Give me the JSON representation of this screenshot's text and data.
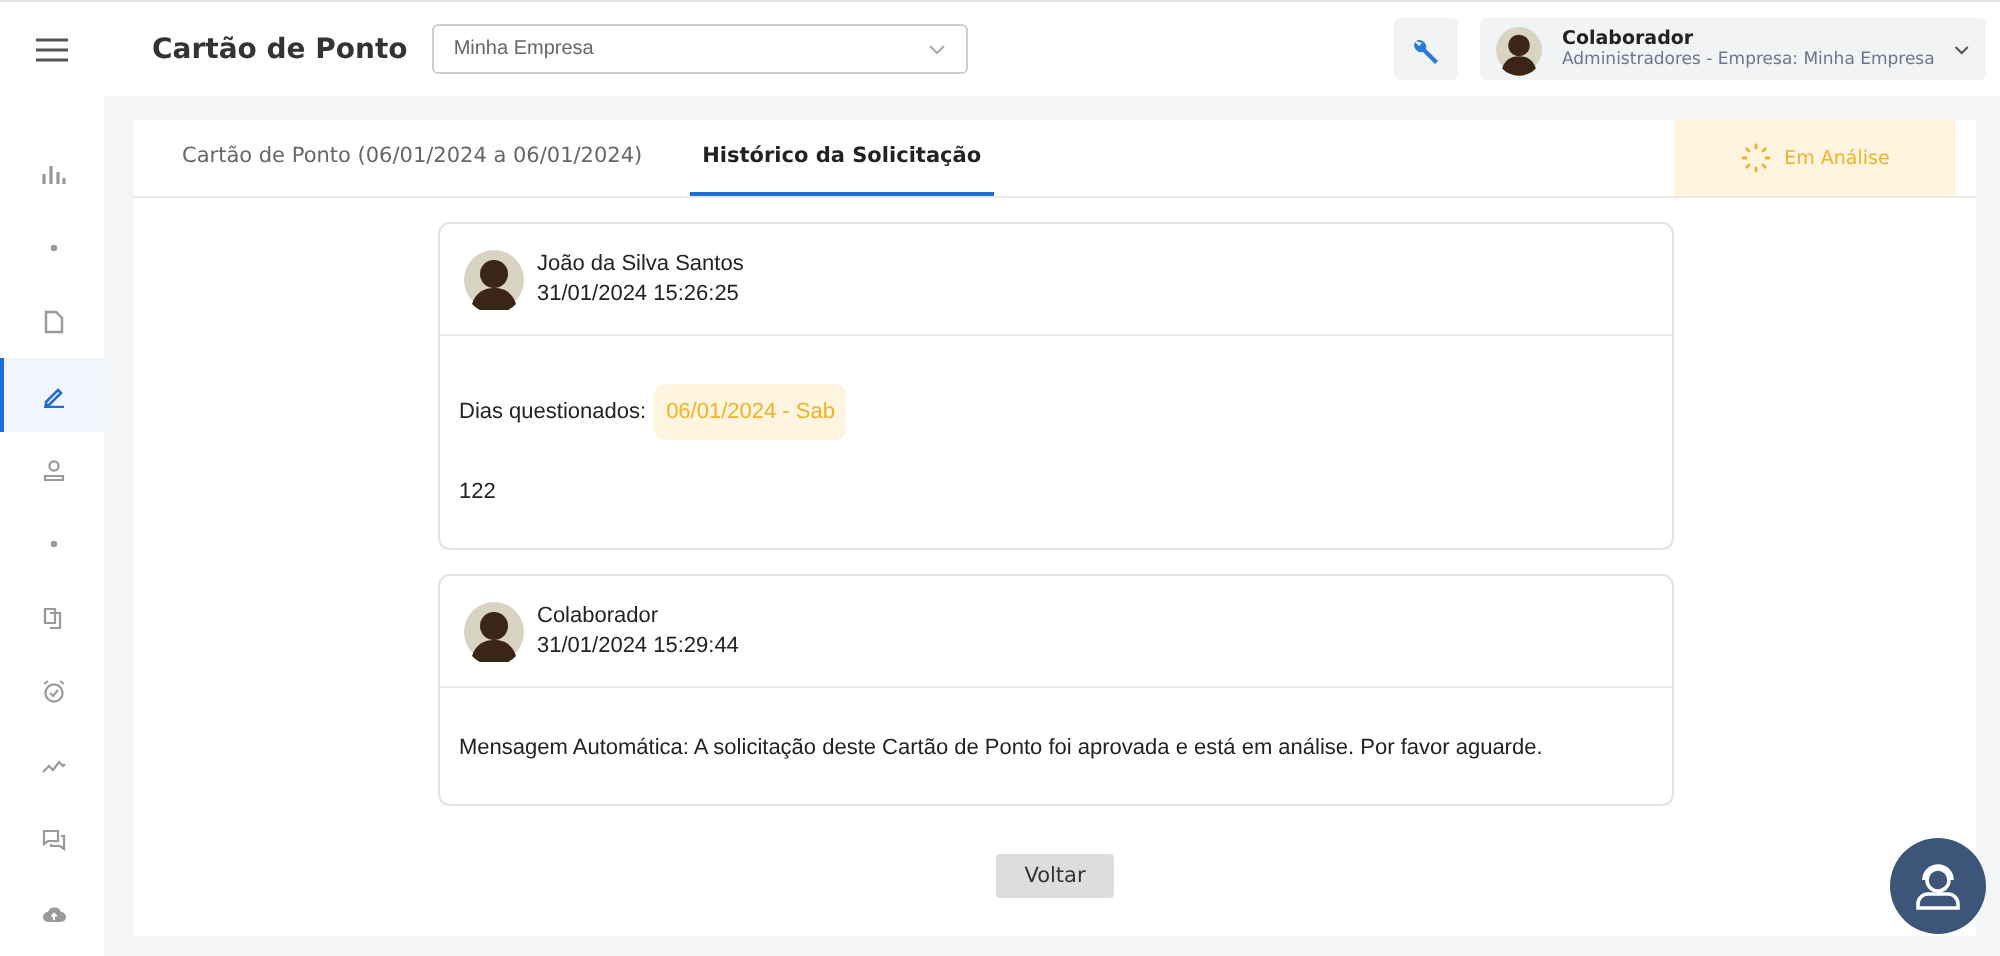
{
  "header": {
    "title": "Cartão de Ponto",
    "company_select": {
      "value": "Minha Empresa"
    },
    "user": {
      "name": "Colaborador",
      "role": "Administradores - Empresa: Minha Empresa"
    }
  },
  "sidebar": {
    "items": [
      {
        "kind": "chart",
        "selected": false
      },
      {
        "kind": "dot",
        "selected": false
      },
      {
        "kind": "file",
        "selected": false
      },
      {
        "kind": "pencil",
        "selected": true
      },
      {
        "kind": "user",
        "selected": false
      },
      {
        "kind": "dot",
        "selected": false
      },
      {
        "kind": "copy",
        "selected": false
      },
      {
        "kind": "alarm",
        "selected": false
      },
      {
        "kind": "trend",
        "selected": false
      },
      {
        "kind": "chat",
        "selected": false
      },
      {
        "kind": "cloud",
        "selected": false
      }
    ]
  },
  "tabs": [
    {
      "label": "Cartão de Ponto (06/01/2024 a 06/01/2024)",
      "selected": false
    },
    {
      "label": "Histórico da Solicitação",
      "selected": true
    }
  ],
  "status": {
    "label": "Em Análise"
  },
  "messages": [
    {
      "author": "João da Silva Santos",
      "time": "31/01/2024 15:26:25",
      "days": {
        "label": "Dias questionados:",
        "chip": "06/01/2024 - Sab"
      },
      "text": "122"
    },
    {
      "author": "Colaborador",
      "time": "31/01/2024 15:29:44",
      "text": "Mensagem Automática: A solicitação deste Cartão de Ponto foi aprovada e está em análise. Por favor aguarde."
    }
  ],
  "back_button": "Voltar"
}
